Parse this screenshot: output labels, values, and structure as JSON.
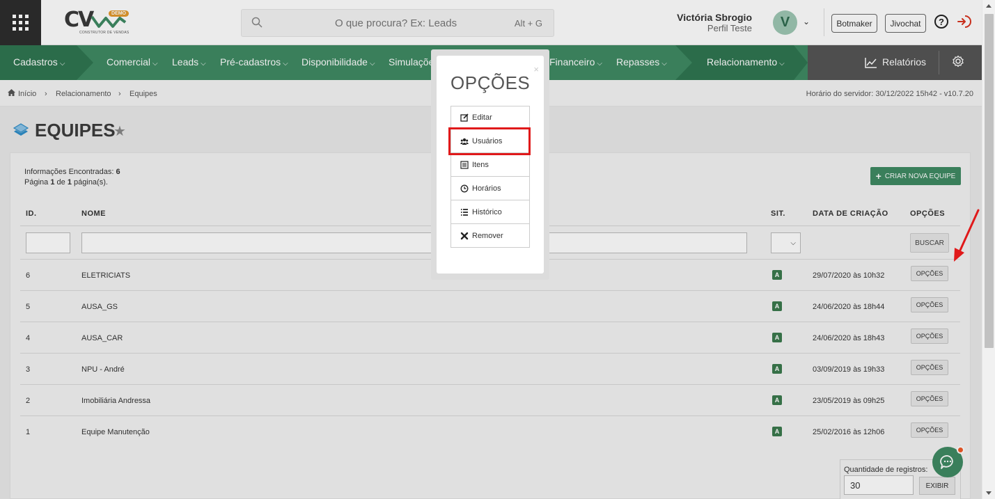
{
  "header": {
    "logo_text": "CV",
    "logo_badge": "DEMO",
    "logo_subtitle": "CONSTRUTOR DE VENDAS",
    "search_placeholder": "O que procura? Ex: Leads",
    "search_shortcut": "Alt + G",
    "user_name": "Victória Sbrogio",
    "user_profile": "Perfil Teste",
    "avatar_initial": "V",
    "botmaker_label": "Botmaker",
    "jivochat_label": "Jivochat",
    "help_label": "?"
  },
  "nav": {
    "items": [
      {
        "label": "Cadastros"
      },
      {
        "label": "Comercial"
      },
      {
        "label": "Leads"
      },
      {
        "label": "Pré-cadastros"
      },
      {
        "label": "Disponibilidade"
      },
      {
        "label": "Simulações"
      },
      {
        "label": "Financeiro"
      },
      {
        "label": "Repasses"
      },
      {
        "label": "Relacionamento"
      }
    ],
    "reports_label": "Relatórios",
    "colors": {
      "green": "#3f8a63",
      "dark": "#555555"
    }
  },
  "breadcrumb": {
    "home": "Início",
    "section": "Relacionamento",
    "current": "Equipes",
    "server_time": "Horário do servidor: 30/12/2022 15h42 - v10.7.20"
  },
  "page": {
    "title": "EQUIPES"
  },
  "info": {
    "found_label": "Informações Encontradas:",
    "found_count": "6",
    "page_word": "Página",
    "page_current": "1",
    "page_of": "de",
    "page_total": "1",
    "page_suffix": "página(s)."
  },
  "create_button": "CRIAR NOVA EQUIPE",
  "table": {
    "headers": {
      "id": "ID.",
      "name": "NOME",
      "sit": "SIT.",
      "created": "DATA DE CRIAÇÃO",
      "options": "OPÇÕES"
    },
    "search_button": "BUSCAR",
    "rows": [
      {
        "id": "6",
        "name": "ELETRICIATS",
        "sit": "A",
        "created": "29/07/2020 às 10h32",
        "options": "OPÇÕES"
      },
      {
        "id": "5",
        "name": "AUSA_GS",
        "sit": "A",
        "created": "24/06/2020 às 18h44",
        "options": "OPÇÕES"
      },
      {
        "id": "4",
        "name": "AUSA_CAR",
        "sit": "A",
        "created": "24/06/2020 às 18h43",
        "options": "OPÇÕES"
      },
      {
        "id": "3",
        "name": "NPU - André",
        "sit": "A",
        "created": "03/09/2019 às 19h33",
        "options": "OPÇÕES"
      },
      {
        "id": "2",
        "name": "Imobiliária Andressa",
        "sit": "A",
        "created": "23/05/2019 às 09h25",
        "options": "OPÇÕES"
      },
      {
        "id": "1",
        "name": "Equipe Manutenção",
        "sit": "A",
        "created": "25/02/2016 às 12h06",
        "options": "OPÇÕES"
      }
    ]
  },
  "records": {
    "label": "Quantidade de registros:",
    "value": "30",
    "button": "EXIBIR"
  },
  "modal": {
    "title": "OPÇÕES",
    "close": "×",
    "items": [
      {
        "label": "Editar",
        "icon": "edit-icon"
      },
      {
        "label": "Usuários",
        "icon": "users-icon"
      },
      {
        "label": "Itens",
        "icon": "list-alt-icon"
      },
      {
        "label": "Horários",
        "icon": "clock-icon"
      },
      {
        "label": "Histórico",
        "icon": "list-icon"
      },
      {
        "label": "Remover",
        "icon": "times-icon"
      }
    ],
    "highlight_color": "#e0191a"
  }
}
